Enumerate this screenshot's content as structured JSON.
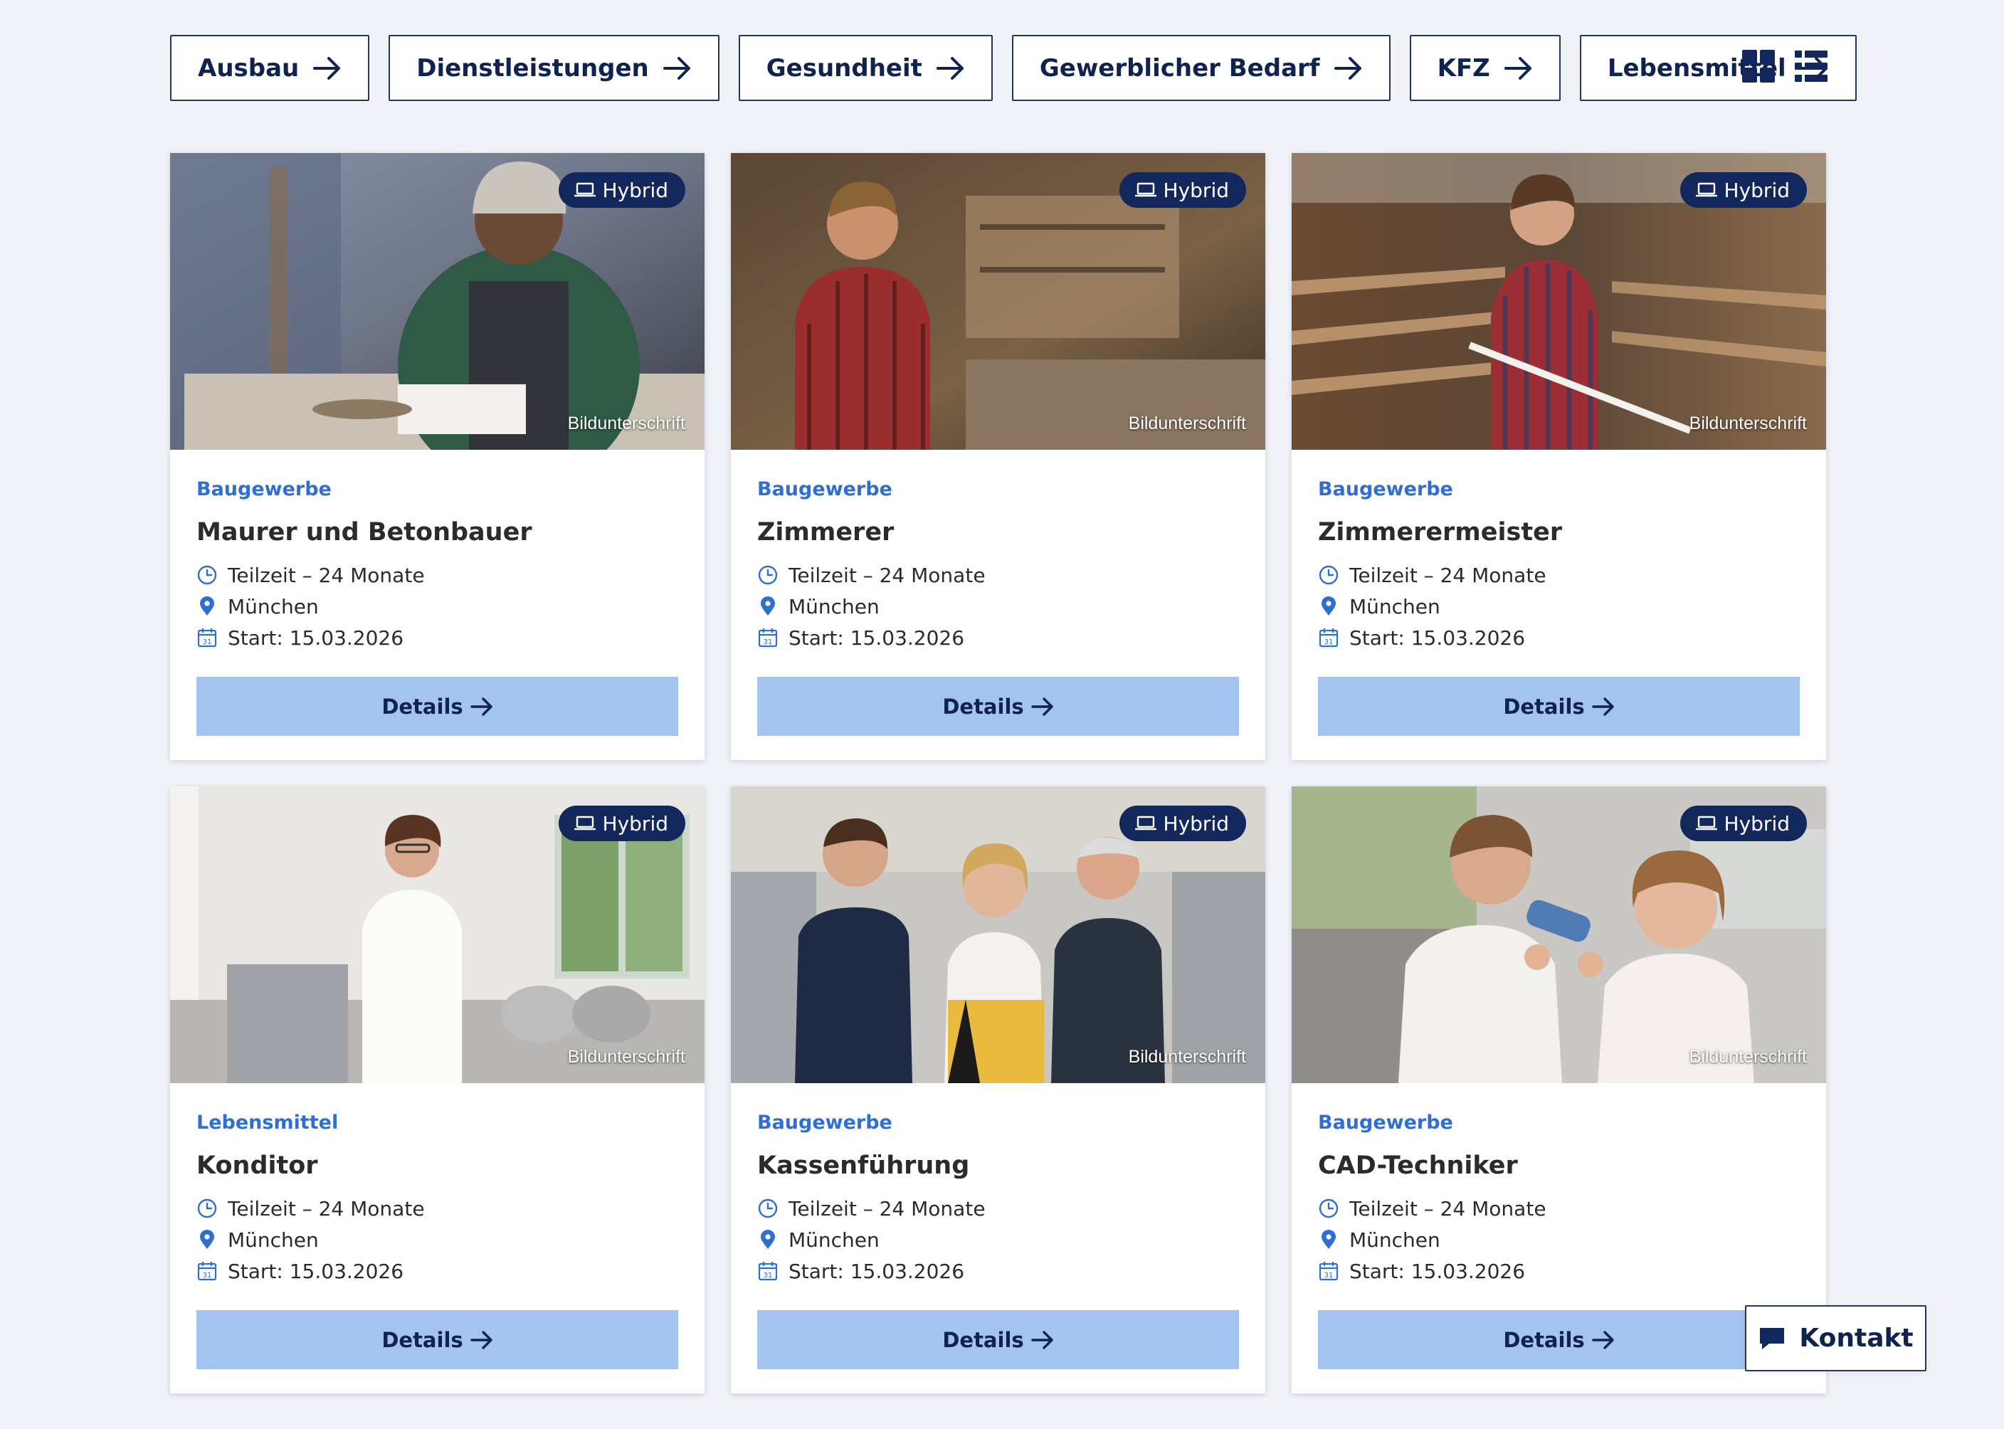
{
  "filters": [
    {
      "label": "Ausbau"
    },
    {
      "label": "Dienstleistungen"
    },
    {
      "label": "Gesundheit"
    },
    {
      "label": "Gewerblicher Bedarf"
    },
    {
      "label": "KFZ"
    },
    {
      "label": "Lebensmittel"
    }
  ],
  "view_toggle": {
    "grid_icon": "grid-view-icon",
    "list_icon": "list-view-icon",
    "active": "grid"
  },
  "cards": [
    {
      "badge": "Hybrid",
      "caption": "Bildunterschrift",
      "category": "Baugewerbe",
      "title": "Maurer und Betonbauer",
      "duration": "Teilzeit – 24 Monate",
      "location": "München",
      "start": "Start: 15.03.2026",
      "button": "Details",
      "photo": "Smiling mason in green sweater and apron smoothing mortar on a block in a workshop"
    },
    {
      "badge": "Hybrid",
      "caption": "Bildunterschrift",
      "category": "Baugewerbe",
      "title": "Zimmerer",
      "duration": "Teilzeit – 24 Monate",
      "location": "München",
      "start": "Start: 15.03.2026",
      "button": "Details",
      "photo": "Carpenter in red plaid shirt standing in a wooden workshop"
    },
    {
      "badge": "Hybrid",
      "caption": "Bildunterschrift",
      "category": "Baugewerbe",
      "title": "Zimmerermeister",
      "duration": "Teilzeit – 24 Monate",
      "location": "München",
      "start": "Start: 15.03.2026",
      "button": "Details",
      "photo": "Woman in plaid shirt holding a folding ruler in a timber workshop"
    },
    {
      "badge": "Hybrid",
      "caption": "Bildunterschrift",
      "category": "Lebensmittel",
      "title": "Konditor",
      "duration": "Teilzeit – 24 Monate",
      "location": "München",
      "start": "Start: 15.03.2026",
      "button": "Details",
      "photo": "Confectioner in white chef jacket standing in a bright bakery kitchen"
    },
    {
      "badge": "Hybrid",
      "caption": "Bildunterschrift",
      "category": "Baugewerbe",
      "title": "Kassenführung",
      "duration": "Teilzeit – 24 Monate",
      "location": "München",
      "start": "Start: 15.03.2026",
      "button": "Details",
      "photo": "Three people standing together in a production workshop"
    },
    {
      "badge": "Hybrid",
      "caption": "Bildunterschrift",
      "category": "Baugewerbe",
      "title": "CAD-Techniker",
      "duration": "Teilzeit – 24 Monate",
      "location": "München",
      "start": "Start: 15.03.2026",
      "button": "Details",
      "photo": "Two people examining a small transparent part in a laboratory"
    }
  ],
  "icons": {
    "badge": "laptop-icon",
    "duration": "clock-icon",
    "location": "map-pin-icon",
    "start": "calendar-icon",
    "button": "arrow-right-icon",
    "kontakt": "chat-bubble-icon"
  },
  "kontakt": {
    "label": "Kontakt"
  },
  "colors": {
    "background": "#f0f2f7",
    "navy": "#10224e",
    "badge": "#12285c",
    "category": "#2f6fd2",
    "button": "#a3c4ef"
  }
}
